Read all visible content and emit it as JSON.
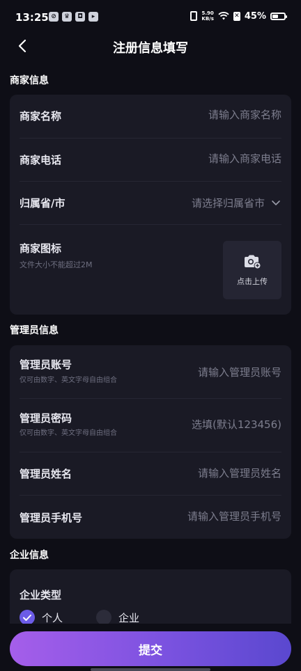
{
  "status_bar": {
    "time": "13:25",
    "net_speed_value": "5.90",
    "net_speed_unit": "KB/s",
    "battery": "45%",
    "battery_level": 0.45,
    "app_icons": [
      "weibo-icon",
      "crown-icon",
      "app-icon",
      "player-icon"
    ]
  },
  "header": {
    "title": "注册信息填写",
    "back_icon": "chevron-left-icon"
  },
  "merchant": {
    "section_title": "商家信息",
    "name_label": "商家名称",
    "name_placeholder": "请输入商家名称",
    "phone_label": "商家电话",
    "phone_placeholder": "请输入商家电话",
    "region_label": "归属省/市",
    "region_placeholder": "请选择归属省市",
    "logo_label": "商家图标",
    "logo_hint": "文件大小不能超过2M",
    "upload_label": "点击上传",
    "upload_icon": "camera-add-icon"
  },
  "admin": {
    "section_title": "管理员信息",
    "account_label": "管理员账号",
    "account_hint": "仅可由数字、英文字母自由组合",
    "account_placeholder": "请输入管理员账号",
    "password_label": "管理员密码",
    "password_hint": "仅可由数字、英文字母自由组合",
    "password_placeholder": "选填(默认123456)",
    "name_label": "管理员姓名",
    "name_placeholder": "请输入管理员姓名",
    "mobile_label": "管理员手机号",
    "mobile_placeholder": "请输入管理员手机号"
  },
  "enterprise": {
    "section_title": "企业信息",
    "type_label": "企业类型",
    "options": [
      {
        "label": "个人",
        "checked": true
      },
      {
        "label": "企业",
        "checked": false
      }
    ]
  },
  "submit": {
    "label": "提交"
  },
  "colors": {
    "background": "#0e0e16",
    "card": "#1a1a25",
    "accent": "#6c5ce7",
    "button_gradient_start": "#a55eea",
    "button_gradient_end": "#5a48cf"
  }
}
